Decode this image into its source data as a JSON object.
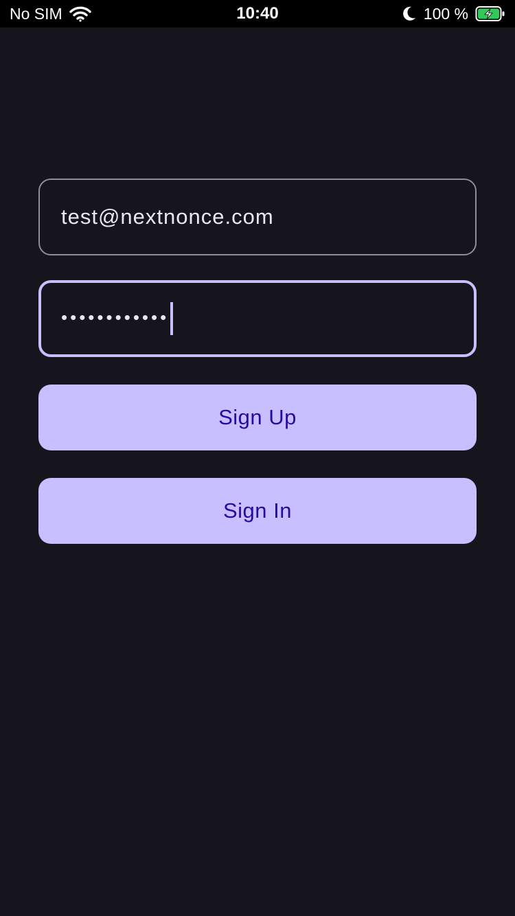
{
  "status_bar": {
    "carrier": "No SIM",
    "time": "10:40",
    "battery_percent": "100 %",
    "icons": [
      "wifi-icon",
      "moon-icon",
      "battery-charging-icon"
    ],
    "battery_color": "#34c759"
  },
  "form": {
    "email": {
      "value": "test@nextnonce.com"
    },
    "password": {
      "masked_value": "••••••••••••"
    }
  },
  "buttons": {
    "sign_up_label": "Sign Up",
    "sign_in_label": "Sign In"
  },
  "colors": {
    "background": "#16141d",
    "accent": "#c7bfff",
    "button_text": "#2a0a9e",
    "outline": "#8f8c98"
  }
}
